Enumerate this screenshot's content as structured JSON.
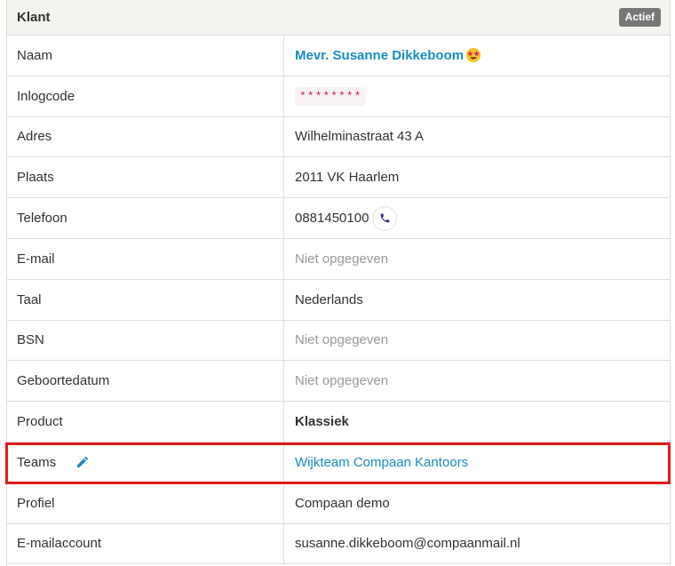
{
  "panel": {
    "title": "Klant",
    "status": "Actief"
  },
  "rows": {
    "naam": {
      "label": "Naam",
      "value": "Mevr. Susanne Dikkeboom"
    },
    "inlogcode": {
      "label": "Inlogcode",
      "value": "********"
    },
    "adres": {
      "label": "Adres",
      "value": "Wilhelminastraat 43 A"
    },
    "plaats": {
      "label": "Plaats",
      "value": "2011 VK Haarlem"
    },
    "telefoon": {
      "label": "Telefoon",
      "value": "0881450100"
    },
    "email": {
      "label": "E-mail",
      "value": "Niet opgegeven"
    },
    "taal": {
      "label": "Taal",
      "value": "Nederlands"
    },
    "bsn": {
      "label": "BSN",
      "value": "Niet opgegeven"
    },
    "geboortedatum": {
      "label": "Geboortedatum",
      "value": "Niet opgegeven"
    },
    "product": {
      "label": "Product",
      "value": "Klassiek"
    },
    "teams": {
      "label": "Teams",
      "value": "Wijkteam Compaan Kantoors"
    },
    "profiel": {
      "label": "Profiel",
      "value": "Compaan demo"
    },
    "emailaccount": {
      "label": "E-mailaccount",
      "value": "susanne.dikkeboom@compaanmail.nl"
    }
  },
  "icons": {
    "name_emoji": "star-struck-emoji-icon",
    "phone": "phone-icon",
    "edit": "pencil-icon"
  },
  "colors": {
    "link": "#1a8bc4",
    "highlight": "#e21a1a",
    "badge": "#777777",
    "muted": "#999999"
  }
}
